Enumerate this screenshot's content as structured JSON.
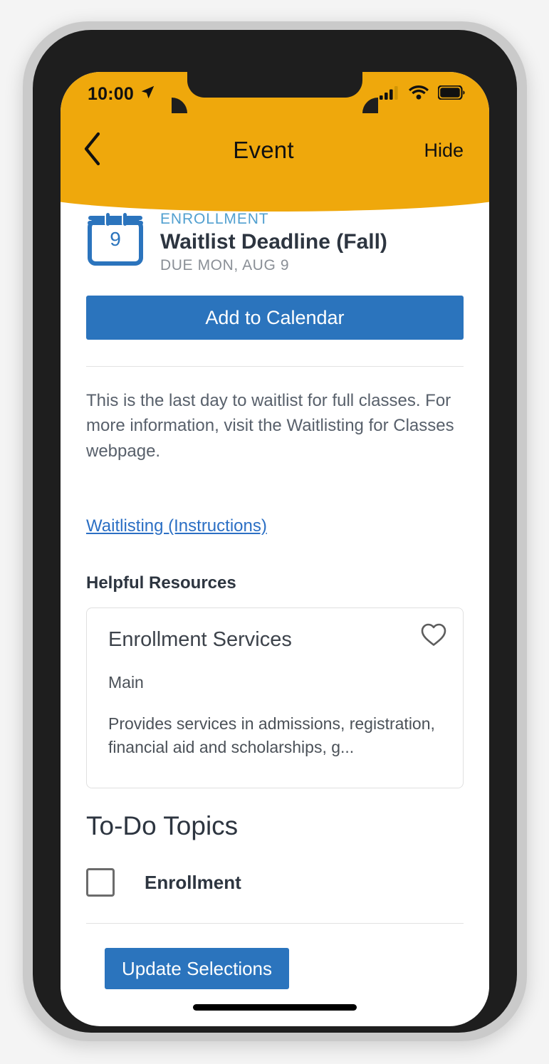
{
  "status_bar": {
    "time": "10:00",
    "location_icon": "location-arrow-icon",
    "signal_icon": "cellular-signal-icon",
    "wifi_icon": "wifi-icon",
    "battery_icon": "battery-full-icon"
  },
  "nav": {
    "back_icon": "chevron-left-icon",
    "title": "Event",
    "hide_label": "Hide"
  },
  "event": {
    "calendar_icon_day": "9",
    "category": "ENROLLMENT",
    "title": "Waitlist Deadline (Fall)",
    "due": "DUE MON, AUG 9",
    "add_to_calendar_label": "Add to Calendar",
    "description": "This is the last day to waitlist for full classes. For more information, visit the Waitlisting for Classes webpage.",
    "link_label": "Waitlisting (Instructions)"
  },
  "resources": {
    "section_title": "Helpful Resources",
    "card": {
      "name": "Enrollment Services",
      "campus": "Main",
      "description": "Provides services in admissions, registration, financial aid and scholarships, g...",
      "favorite_icon": "heart-outline-icon"
    }
  },
  "todo": {
    "section_title": "To-Do Topics",
    "items": [
      {
        "label": "Enrollment",
        "checked": false
      }
    ],
    "update_label": "Update Selections"
  },
  "colors": {
    "header_yellow": "#efa80c",
    "primary_blue": "#2b74bd",
    "category_blue": "#52a0d0",
    "link_blue": "#2b6fc4",
    "text_dark": "#2d3540",
    "text_muted": "#58606b"
  }
}
